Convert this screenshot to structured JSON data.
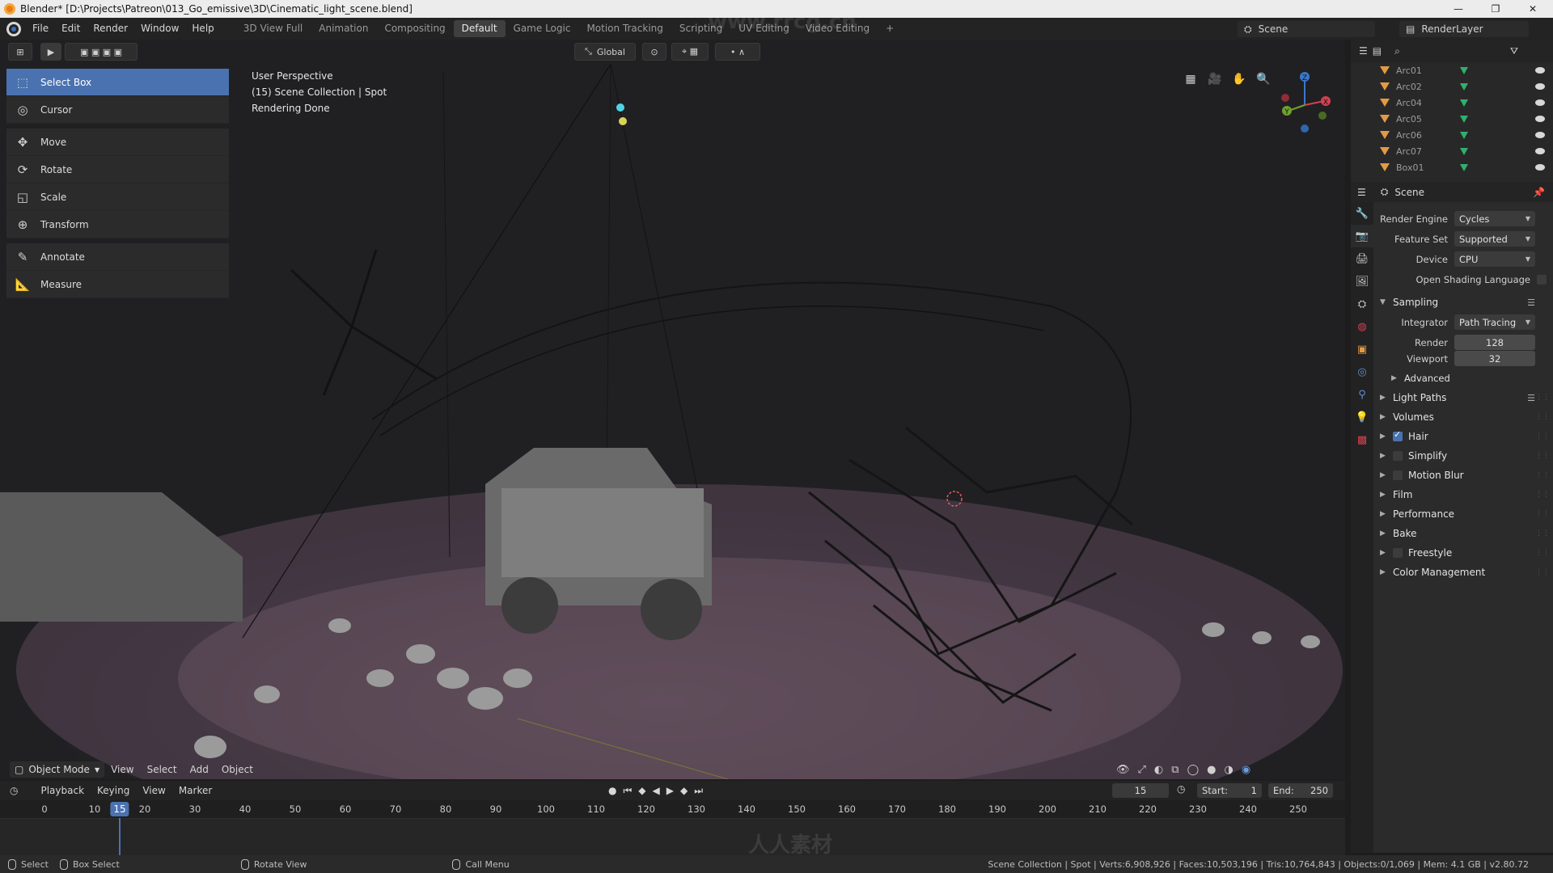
{
  "window": {
    "title": "Blender* [D:\\Projects\\Patreon\\013_Go_emissive\\3D\\Cinematic_light_scene.blend]",
    "minimize": "—",
    "restore": "❐",
    "close": "✕"
  },
  "menu": [
    "File",
    "Edit",
    "Render",
    "Window",
    "Help"
  ],
  "workspaces": [
    "3D View Full",
    "Animation",
    "Compositing",
    "Default",
    "Game Logic",
    "Motion Tracking",
    "Scripting",
    "UV Editing",
    "Video Editing"
  ],
  "workspace_active": "Default",
  "workspace_add": "+",
  "scene": {
    "label": "Scene",
    "view_layer": "RenderLayer"
  },
  "viewport": {
    "transform_orientation": "Global",
    "info": [
      "User Perspective",
      "(15) Scene Collection | Spot",
      "Rendering Done"
    ],
    "mode": "Object Mode",
    "footer_menu": [
      "View",
      "Select",
      "Add",
      "Object"
    ]
  },
  "tools": [
    "Select Box",
    "Cursor",
    "Move",
    "Rotate",
    "Scale",
    "Transform",
    "Annotate",
    "Measure"
  ],
  "gizmo": {
    "x": "X",
    "y": "Y",
    "z": "Z"
  },
  "outliner": [
    "Arc01",
    "Arc02",
    "Arc04",
    "Arc05",
    "Arc06",
    "Arc07",
    "Box01"
  ],
  "properties": {
    "header": "Scene",
    "render_engine": {
      "label": "Render Engine",
      "value": "Cycles"
    },
    "feature_set": {
      "label": "Feature Set",
      "value": "Supported"
    },
    "device": {
      "label": "Device",
      "value": "CPU"
    },
    "osl": "Open Shading Language",
    "sampling": {
      "title": "Sampling",
      "integrator": {
        "label": "Integrator",
        "value": "Path Tracing"
      },
      "render": {
        "label": "Render",
        "value": "128"
      },
      "viewport": {
        "label": "Viewport",
        "value": "32"
      },
      "advanced": "Advanced"
    },
    "panels": [
      {
        "name": "Light Paths",
        "checkbox": null,
        "list": true
      },
      {
        "name": "Volumes",
        "checkbox": null,
        "list": false
      },
      {
        "name": "Hair",
        "checkbox": true,
        "list": false
      },
      {
        "name": "Simplify",
        "checkbox": false,
        "list": false
      },
      {
        "name": "Motion Blur",
        "checkbox": false,
        "list": false
      },
      {
        "name": "Film",
        "checkbox": null,
        "list": false
      },
      {
        "name": "Performance",
        "checkbox": null,
        "list": false
      },
      {
        "name": "Bake",
        "checkbox": null,
        "list": false
      },
      {
        "name": "Freestyle",
        "checkbox": false,
        "list": false
      },
      {
        "name": "Color Management",
        "checkbox": null,
        "list": false
      }
    ]
  },
  "timeline": {
    "menu": [
      "Playback",
      "Keying",
      "View",
      "Marker"
    ],
    "current_frame": "15",
    "start_label": "Start:",
    "start": "1",
    "end_label": "End:",
    "end": "250",
    "ticks": [
      "0",
      "10",
      "15",
      "20",
      "30",
      "40",
      "50",
      "60",
      "70",
      "80",
      "90",
      "100",
      "110",
      "120",
      "130",
      "140",
      "150",
      "160",
      "170",
      "180",
      "190",
      "200",
      "210",
      "220",
      "230",
      "240",
      "250"
    ]
  },
  "status": {
    "select": "Select",
    "box_select": "Box Select",
    "rotate_view": "Rotate View",
    "call_menu": "Call Menu",
    "stats": "Scene Collection | Spot | Verts:6,908,926 | Faces:10,503,196 | Tris:10,764,843 | Objects:0/1,069 | Mem: 4.1 GB | v2.80.72"
  },
  "watermarks": {
    "top": "www.rrcg.cn",
    "bottom": "人人素材"
  }
}
